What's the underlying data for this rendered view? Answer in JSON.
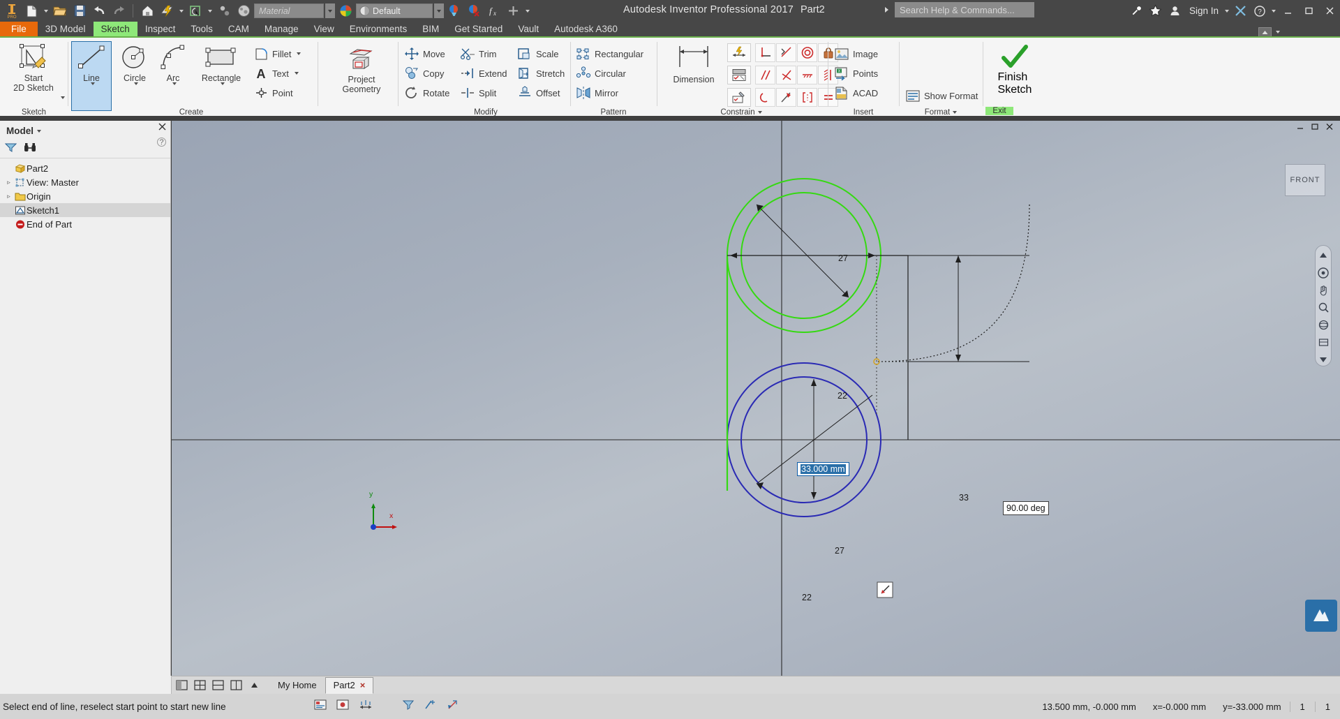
{
  "app": {
    "title": "Autodesk Inventor Professional 2017",
    "document": "Part2",
    "search_placeholder": "Search Help & Commands...",
    "sign_in": "Sign In",
    "material_placeholder": "Material",
    "appearance_value": "Default"
  },
  "quick_access": [
    {
      "name": "inventor-logo-icon",
      "label": "PRO"
    },
    {
      "name": "new-file-icon",
      "label": "New"
    },
    {
      "name": "open-file-icon",
      "label": "Open"
    },
    {
      "name": "save-icon",
      "label": "Save"
    },
    {
      "name": "undo-icon",
      "label": "Undo"
    },
    {
      "name": "redo-icon",
      "label": "Redo"
    },
    {
      "name": "home-icon",
      "label": "Home"
    },
    {
      "name": "update-icon",
      "label": "Update"
    },
    {
      "name": "select-icon",
      "label": "Select"
    },
    {
      "name": "appearance-icon",
      "label": "Appearance"
    },
    {
      "name": "material-icon",
      "label": "Material"
    }
  ],
  "menu_tabs": [
    {
      "label": "File",
      "state": "file"
    },
    {
      "label": "3D Model",
      "state": "normal"
    },
    {
      "label": "Sketch",
      "state": "active"
    },
    {
      "label": "Inspect",
      "state": "normal"
    },
    {
      "label": "Tools",
      "state": "normal"
    },
    {
      "label": "CAM",
      "state": "normal"
    },
    {
      "label": "Manage",
      "state": "normal"
    },
    {
      "label": "View",
      "state": "normal"
    },
    {
      "label": "Environments",
      "state": "normal"
    },
    {
      "label": "BIM",
      "state": "normal"
    },
    {
      "label": "Get Started",
      "state": "normal"
    },
    {
      "label": "Vault",
      "state": "normal"
    },
    {
      "label": "Autodesk A360",
      "state": "normal"
    }
  ],
  "ribbon": {
    "groups": [
      {
        "key": "sketch",
        "label": "Sketch"
      },
      {
        "key": "create",
        "label": "Create"
      },
      {
        "key": "modify",
        "label": "Modify"
      },
      {
        "key": "pattern",
        "label": "Pattern"
      },
      {
        "key": "constrain",
        "label": "Constrain"
      },
      {
        "key": "insert",
        "label": "Insert"
      },
      {
        "key": "format",
        "label": "Format"
      },
      {
        "key": "exit",
        "label": "Exit"
      }
    ],
    "sketch": {
      "start_2d_sketch": "Start\n2D Sketch"
    },
    "create": {
      "line": "Line",
      "circle": "Circle",
      "arc": "Arc",
      "rectangle": "Rectangle",
      "fillet": "Fillet",
      "text": "Text",
      "point": "Point",
      "project_geometry": "Project\nGeometry"
    },
    "modify": {
      "move": "Move",
      "copy": "Copy",
      "rotate": "Rotate",
      "trim": "Trim",
      "extend": "Extend",
      "split": "Split",
      "scale": "Scale",
      "stretch": "Stretch",
      "offset": "Offset"
    },
    "pattern": {
      "rectangular": "Rectangular",
      "circular": "Circular",
      "mirror": "Mirror"
    },
    "constrain": {
      "dimension": "Dimension"
    },
    "insert": {
      "image": "Image",
      "points": "Points",
      "acad": "ACAD"
    },
    "format": {
      "show_format": "Show Format"
    },
    "exit": {
      "finish_sketch": "Finish\nSketch",
      "exit_label": "Exit"
    }
  },
  "model_panel": {
    "title": "Model",
    "filter_icon": "filter-icon",
    "find_icon": "binoculars-icon",
    "tree": [
      {
        "label": "Part2",
        "icon": "part-icon",
        "indent": 0,
        "expander": "",
        "selected": false
      },
      {
        "label": "View: Master",
        "icon": "view-icon",
        "indent": 1,
        "expander": "▹",
        "selected": false
      },
      {
        "label": "Origin",
        "icon": "origin-folder-icon",
        "indent": 1,
        "expander": "▹",
        "selected": false
      },
      {
        "label": "Sketch1",
        "icon": "sketch-icon",
        "indent": 1,
        "expander": "",
        "selected": true
      },
      {
        "label": "End of Part",
        "icon": "end-of-part-icon",
        "indent": 1,
        "expander": "",
        "selected": false
      }
    ]
  },
  "canvas": {
    "view_cube_label": "FRONT",
    "dimension_edit_value": "33.000 mm",
    "angle_dimension": "90.00 deg",
    "radius_labels": [
      "27",
      "22",
      "27",
      "22"
    ],
    "linear_label": "33",
    "axis_x": "x",
    "axis_y": "y"
  },
  "document_tabs": [
    {
      "label": "My Home",
      "active": false,
      "closable": false
    },
    {
      "label": "Part2",
      "active": true,
      "closable": true
    }
  ],
  "status_bar": {
    "message": "Select end of line, reselect start point to start new line",
    "coordinate": "13.500 mm, -0.000 mm",
    "x_value": "x=-0.000 mm",
    "y_value": "y=-33.000 mm",
    "count_a": "1",
    "count_b": "1"
  },
  "colors": {
    "accent_orange": "#e8690b",
    "accent_green": "#8ee879",
    "sketch_green": "#35d912",
    "sketch_blue": "#2a2ab4",
    "ribbon_bg": "#f5f5f5",
    "titlebar_bg": "#474747"
  }
}
